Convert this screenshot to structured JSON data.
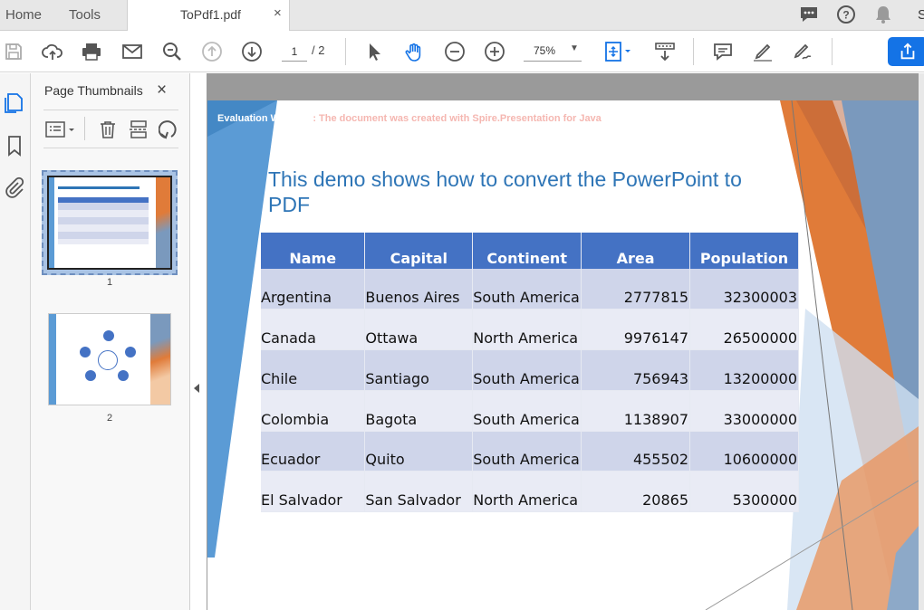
{
  "tabs": {
    "home": "Home",
    "tools": "Tools",
    "document": "ToPdf1.pdf",
    "close_glyph": "×",
    "cut_off": "S"
  },
  "toolbar": {
    "page_current": "1",
    "page_total": "/ 2",
    "zoom": "75%"
  },
  "thumbnails": {
    "title": "Page Thumbnails",
    "close_glyph": "×",
    "pages": [
      "1",
      "2"
    ]
  },
  "document": {
    "watermark_prefix": "Evaluation Warning",
    "watermark_rest": " : The document was created with  Spire.Presentation for Java",
    "title": "This demo shows how to convert the PowerPoint to PDF",
    "table": {
      "headers": [
        "Name",
        "Capital",
        "Continent",
        "Area",
        "Population"
      ],
      "rows": [
        [
          "Argentina",
          "Buenos Aires",
          "South America",
          "2777815",
          "32300003"
        ],
        [
          "Canada",
          "Ottawa",
          "North America",
          "9976147",
          "26500000"
        ],
        [
          "Chile",
          "Santiago",
          "South America",
          "756943",
          "13200000"
        ],
        [
          "Colombia",
          "Bagota",
          "South America",
          "1138907",
          "33000000"
        ],
        [
          "Ecuador",
          "Quito",
          "South America",
          "455502",
          "10600000"
        ],
        [
          "El Salvador",
          "San Salvador",
          "North America",
          "20865",
          "5300000"
        ]
      ]
    }
  },
  "colors": {
    "accent_blue": "#1473e6",
    "table_header": "#4472c4",
    "title_blue": "#2e75b6",
    "slide_orange": "#e07b39",
    "slide_blue": "#5b9bd5"
  }
}
